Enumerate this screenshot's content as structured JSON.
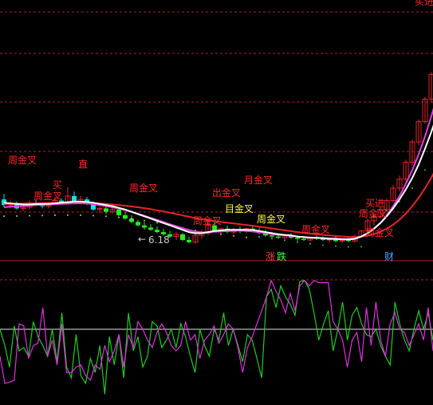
{
  "colors": {
    "background": "#000000",
    "grid_dash": "#b0202a",
    "divider": "#b0202a",
    "candle_up": "#e8242a",
    "candle_down": "#00e6e6",
    "candle_green": "#22ee22",
    "ma_white": "#ffffff",
    "ma_magenta": "#e040e0",
    "ma_red": "#e8242a",
    "dots_yellow": "#d7c060",
    "dots_green": "#22cc22",
    "signal_text": "#ff2a2a",
    "signal_text_yellow": "#ffff33",
    "osc_green": "#22cc22",
    "osc_magenta": "#dd33dd",
    "osc_baseline": "#e6e6e6",
    "legend_zhang": "#ff4444",
    "legend_die": "#44ff44",
    "legend_cai": "#44aaff"
  },
  "chart_data": [
    {
      "type": "candlestick",
      "panel": "price",
      "annotations": [
        {
          "text": "周金叉",
          "x": 1
        },
        {
          "text": "直",
          "x": 12
        },
        {
          "text": "周金叉",
          "x": 5
        },
        {
          "text": "买",
          "x": 8
        },
        {
          "text": "周金叉",
          "x": 20
        },
        {
          "text": "月金叉",
          "x": 38
        },
        {
          "text": "出金叉",
          "x": 33
        },
        {
          "text": "周金叉",
          "x": 30
        },
        {
          "text": "目金叉",
          "x": 35
        },
        {
          "text": "周金叉",
          "x": 40
        },
        {
          "text": "周金叉",
          "x": 47
        },
        {
          "text": "周金叉",
          "x": 56
        },
        {
          "text": "买进",
          "x": 57
        },
        {
          "text": "周金叉",
          "x": 57
        },
        {
          "text": "买进",
          "x": 95
        }
      ],
      "price_label": "6.18",
      "candles": [
        {
          "o": 14.3,
          "h": 14.8,
          "l": 13.6,
          "c": 13.8
        },
        {
          "o": 13.8,
          "h": 14.2,
          "l": 13.5,
          "c": 13.9
        },
        {
          "o": 13.9,
          "h": 14.1,
          "l": 13.4,
          "c": 13.5
        },
        {
          "o": 13.5,
          "h": 13.9,
          "l": 13.2,
          "c": 13.6
        },
        {
          "o": 13.6,
          "h": 14.2,
          "l": 13.4,
          "c": 14.0
        },
        {
          "o": 14.0,
          "h": 14.3,
          "l": 13.7,
          "c": 13.8
        },
        {
          "o": 13.8,
          "h": 14.0,
          "l": 13.5,
          "c": 13.7
        },
        {
          "o": 13.7,
          "h": 14.1,
          "l": 13.5,
          "c": 13.9
        },
        {
          "o": 13.9,
          "h": 14.5,
          "l": 13.8,
          "c": 14.2
        },
        {
          "o": 14.2,
          "h": 14.4,
          "l": 13.9,
          "c": 14.0
        },
        {
          "o": 14.0,
          "h": 15.4,
          "l": 13.9,
          "c": 14.6
        },
        {
          "o": 14.6,
          "h": 15.0,
          "l": 14.0,
          "c": 14.1
        },
        {
          "o": 14.1,
          "h": 14.6,
          "l": 13.9,
          "c": 14.3
        },
        {
          "o": 14.3,
          "h": 14.5,
          "l": 13.8,
          "c": 13.9
        },
        {
          "o": 13.9,
          "h": 14.1,
          "l": 13.3,
          "c": 13.4
        },
        {
          "o": 13.4,
          "h": 13.8,
          "l": 13.1,
          "c": 13.5
        },
        {
          "o": 13.5,
          "h": 13.7,
          "l": 13.0,
          "c": 13.2
        },
        {
          "o": 13.2,
          "h": 13.6,
          "l": 13.0,
          "c": 13.4
        },
        {
          "o": 13.4,
          "h": 13.5,
          "l": 12.8,
          "c": 12.9
        },
        {
          "o": 12.9,
          "h": 13.2,
          "l": 12.5,
          "c": 12.6
        },
        {
          "o": 12.6,
          "h": 12.9,
          "l": 12.2,
          "c": 12.3
        },
        {
          "o": 12.3,
          "h": 12.5,
          "l": 11.9,
          "c": 12.0
        },
        {
          "o": 12.0,
          "h": 12.3,
          "l": 11.6,
          "c": 11.8
        },
        {
          "o": 11.8,
          "h": 12.1,
          "l": 11.5,
          "c": 11.6
        },
        {
          "o": 11.6,
          "h": 11.9,
          "l": 11.3,
          "c": 11.4
        },
        {
          "o": 11.4,
          "h": 11.7,
          "l": 11.1,
          "c": 11.2
        },
        {
          "o": 11.2,
          "h": 11.5,
          "l": 10.9,
          "c": 11.0
        },
        {
          "o": 11.0,
          "h": 11.4,
          "l": 10.7,
          "c": 11.2
        },
        {
          "o": 11.2,
          "h": 11.3,
          "l": 10.6,
          "c": 10.7
        },
        {
          "o": 10.7,
          "h": 11.0,
          "l": 10.4,
          "c": 10.5
        },
        {
          "o": 10.5,
          "h": 11.3,
          "l": 10.4,
          "c": 11.1
        },
        {
          "o": 11.1,
          "h": 11.6,
          "l": 10.8,
          "c": 11.3
        },
        {
          "o": 11.3,
          "h": 12.4,
          "l": 11.1,
          "c": 12.0
        },
        {
          "o": 12.0,
          "h": 12.3,
          "l": 11.4,
          "c": 11.5
        },
        {
          "o": 11.5,
          "h": 11.8,
          "l": 11.2,
          "c": 11.7
        },
        {
          "o": 11.7,
          "h": 12.0,
          "l": 11.3,
          "c": 11.4
        },
        {
          "o": 11.4,
          "h": 11.8,
          "l": 11.2,
          "c": 11.6
        },
        {
          "o": 11.6,
          "h": 11.9,
          "l": 11.3,
          "c": 11.5
        },
        {
          "o": 11.5,
          "h": 11.8,
          "l": 11.3,
          "c": 11.7
        },
        {
          "o": 11.7,
          "h": 12.0,
          "l": 11.4,
          "c": 11.5
        },
        {
          "o": 11.5,
          "h": 11.8,
          "l": 11.2,
          "c": 11.3
        },
        {
          "o": 11.3,
          "h": 11.6,
          "l": 11.0,
          "c": 11.1
        },
        {
          "o": 11.1,
          "h": 11.4,
          "l": 10.9,
          "c": 11.0
        },
        {
          "o": 11.0,
          "h": 11.3,
          "l": 10.8,
          "c": 10.9
        },
        {
          "o": 10.9,
          "h": 11.2,
          "l": 10.7,
          "c": 11.1
        },
        {
          "o": 11.1,
          "h": 11.3,
          "l": 10.8,
          "c": 10.9
        },
        {
          "o": 10.9,
          "h": 11.1,
          "l": 10.6,
          "c": 10.8
        },
        {
          "o": 10.8,
          "h": 11.0,
          "l": 10.6,
          "c": 10.7
        },
        {
          "o": 10.7,
          "h": 11.0,
          "l": 10.6,
          "c": 10.9
        },
        {
          "o": 10.9,
          "h": 11.1,
          "l": 10.7,
          "c": 10.8
        },
        {
          "o": 10.8,
          "h": 11.0,
          "l": 10.6,
          "c": 10.7
        },
        {
          "o": 10.7,
          "h": 10.9,
          "l": 10.5,
          "c": 10.8
        },
        {
          "o": 10.8,
          "h": 11.0,
          "l": 10.5,
          "c": 10.6
        },
        {
          "o": 10.6,
          "h": 10.8,
          "l": 10.4,
          "c": 10.7
        },
        {
          "o": 10.7,
          "h": 10.9,
          "l": 10.5,
          "c": 10.6
        },
        {
          "o": 10.6,
          "h": 11.2,
          "l": 10.5,
          "c": 11.0
        },
        {
          "o": 11.0,
          "h": 11.6,
          "l": 10.9,
          "c": 11.5
        },
        {
          "o": 11.5,
          "h": 12.6,
          "l": 11.3,
          "c": 12.4
        },
        {
          "o": 12.4,
          "h": 13.0,
          "l": 12.0,
          "c": 12.8
        },
        {
          "o": 12.8,
          "h": 13.6,
          "l": 12.6,
          "c": 13.4
        },
        {
          "o": 13.4,
          "h": 14.4,
          "l": 13.2,
          "c": 14.2
        },
        {
          "o": 14.2,
          "h": 15.6,
          "l": 14.0,
          "c": 15.3
        },
        {
          "o": 15.3,
          "h": 16.4,
          "l": 15.0,
          "c": 16.1
        },
        {
          "o": 16.1,
          "h": 17.8,
          "l": 15.9,
          "c": 17.6
        },
        {
          "o": 17.6,
          "h": 19.6,
          "l": 17.3,
          "c": 19.4
        },
        {
          "o": 19.4,
          "h": 21.4,
          "l": 19.1,
          "c": 21.2
        },
        {
          "o": 21.2,
          "h": 23.4,
          "l": 21.0,
          "c": 23.2
        },
        {
          "o": 23.2,
          "h": 25.6,
          "l": 22.9,
          "c": 25.4
        },
        {
          "o": 25.4,
          "h": 27.6,
          "l": 25.0,
          "c": 27.3
        },
        {
          "o": 27.3,
          "h": 29.4,
          "l": 27.0,
          "c": 29.2
        },
        {
          "o": 29.2,
          "h": 31.0,
          "l": 28.4,
          "c": 30.5
        },
        {
          "o": 30.5,
          "h": 32.0,
          "l": 29.6,
          "c": 31.6
        },
        {
          "o": 31.6,
          "h": 32.6,
          "l": 30.8,
          "c": 32.2
        }
      ],
      "ma_white": [
        14.0,
        13.95,
        13.9,
        13.85,
        13.85,
        13.88,
        13.9,
        13.9,
        13.95,
        14.0,
        14.05,
        14.1,
        14.1,
        14.08,
        14.0,
        13.9,
        13.8,
        13.7,
        13.55,
        13.4,
        13.2,
        13.0,
        12.8,
        12.6,
        12.4,
        12.2,
        12.0,
        11.8,
        11.6,
        11.4,
        11.3,
        11.3,
        11.4,
        11.5,
        11.55,
        11.6,
        11.6,
        11.6,
        11.6,
        11.58,
        11.5,
        11.4,
        11.3,
        11.2,
        11.15,
        11.1,
        11.0,
        10.95,
        10.9,
        10.9,
        10.85,
        10.8,
        10.8,
        10.75,
        10.75,
        10.8,
        11.0,
        11.3,
        11.7,
        12.2,
        12.8,
        13.5,
        14.3,
        15.2,
        16.2,
        17.4,
        18.8,
        20.3,
        22.0,
        23.8,
        25.6,
        27.4,
        29.2
      ],
      "ma_magenta": [
        13.6,
        13.65,
        13.7,
        13.72,
        13.75,
        13.8,
        13.83,
        13.85,
        13.88,
        13.9,
        13.92,
        13.95,
        13.95,
        13.93,
        13.88,
        13.8,
        13.7,
        13.6,
        13.48,
        13.35,
        13.2,
        13.02,
        12.85,
        12.66,
        12.48,
        12.3,
        12.1,
        11.92,
        11.75,
        11.58,
        11.45,
        11.38,
        11.38,
        11.42,
        11.45,
        11.5,
        11.52,
        11.52,
        11.5,
        11.45,
        11.38,
        11.3,
        11.22,
        11.15,
        11.1,
        11.05,
        11.0,
        10.96,
        10.92,
        10.9,
        10.88,
        10.85,
        10.82,
        10.8,
        10.78,
        10.82,
        11.0,
        11.3,
        11.7,
        12.2,
        12.9,
        13.7,
        14.6,
        15.7,
        16.9,
        18.3,
        19.9,
        21.7,
        23.6,
        25.6,
        27.6,
        29.7,
        31.8
      ],
      "ma_red": [
        13.9,
        13.9,
        13.92,
        13.93,
        13.95,
        13.96,
        13.97,
        13.98,
        13.99,
        14.0,
        14.0,
        14.0,
        14.0,
        13.98,
        13.96,
        13.93,
        13.9,
        13.85,
        13.8,
        13.74,
        13.68,
        13.6,
        13.52,
        13.43,
        13.33,
        13.23,
        13.12,
        13.0,
        12.88,
        12.76,
        12.64,
        12.54,
        12.45,
        12.37,
        12.3,
        12.23,
        12.17,
        12.1,
        12.03,
        11.96,
        11.88,
        11.8,
        11.72,
        11.64,
        11.56,
        11.48,
        11.4,
        11.33,
        11.26,
        11.2,
        11.15,
        11.1,
        11.05,
        11.01,
        10.98,
        10.97,
        11.0,
        11.08,
        11.22,
        11.42,
        11.7,
        12.05,
        12.5,
        13.05,
        13.7,
        14.45,
        15.3,
        16.25,
        17.3,
        18.45,
        19.7,
        21.0,
        22.4
      ],
      "ylim": [
        9,
        32
      ]
    },
    {
      "type": "line",
      "panel": "oscillator",
      "series": [
        {
          "color_key": "osc_green",
          "values": [
            55,
            40,
            20,
            58,
            35,
            38,
            30,
            62,
            48,
            40,
            30,
            55,
            25,
            70,
            20,
            10,
            50,
            12,
            5,
            28,
            15,
            40,
            -5,
            48,
            22,
            50,
            10,
            70,
            35,
            48,
            20,
            30,
            62,
            58,
            38,
            45,
            55,
            38,
            60,
            48,
            30,
            15,
            55,
            40,
            30,
            55,
            45,
            70,
            40,
            55,
            40,
            25,
            50,
            45,
            28,
            10,
            85,
            92,
            75,
            95,
            85,
            78,
            68,
            99,
            100,
            92,
            70,
            45,
            60,
            72,
            35,
            55,
            80,
            45,
            68,
            75,
            60,
            50,
            48,
            55,
            40,
            30,
            22,
            80,
            60,
            45,
            35,
            55,
            72,
            55,
            70,
            45
          ]
        },
        {
          "color_key": "osc_magenta",
          "values": [
            30,
            5,
            6,
            8,
            60,
            58,
            28,
            40,
            42,
            75,
            30,
            45,
            22,
            60,
            15,
            15,
            20,
            22,
            12,
            8,
            22,
            18,
            40,
            25,
            35,
            50,
            20,
            50,
            38,
            62,
            55,
            45,
            38,
            52,
            60,
            52,
            40,
            35,
            40,
            62,
            45,
            50,
            28,
            45,
            50,
            58,
            42,
            50,
            60,
            55,
            38,
            15,
            38,
            48,
            60,
            72,
            85,
            100,
            90,
            82,
            70,
            88,
            72,
            95,
            100,
            95,
            100,
            98,
            98,
            98,
            62,
            55,
            45,
            20,
            45,
            52,
            25,
            75,
            40,
            80,
            45,
            30,
            60,
            70,
            55,
            52,
            40,
            50,
            60,
            45,
            75,
            35
          ]
        }
      ],
      "baseline": 50,
      "ylim": [
        -15,
        105
      ]
    }
  ],
  "legend": {
    "zhang": "涨",
    "die": "跌",
    "cai": "财"
  }
}
